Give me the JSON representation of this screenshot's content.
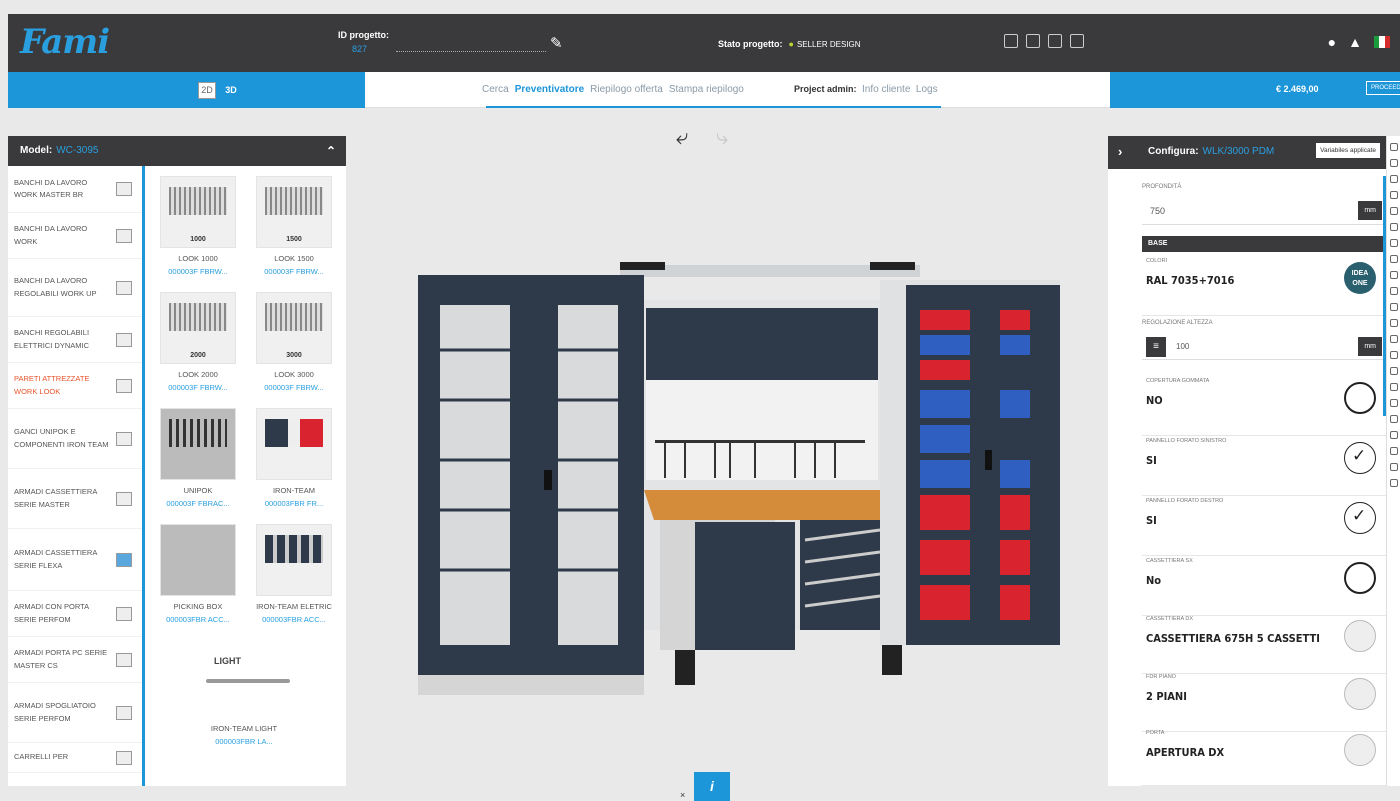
{
  "header": {
    "logo": "Fami",
    "id_label": "ID progetto:",
    "id_value": "827",
    "status_label": "Stato progetto:",
    "status_value": "SELLER DESIGN",
    "icons": [
      "file-icon",
      "save-icon",
      "folder-icon",
      "grid-icon"
    ],
    "user_icons": [
      "user-icon",
      "bell-icon",
      "italian-flag-icon"
    ]
  },
  "nav": {
    "view_2d": "2D",
    "view_3d": "3D",
    "tabs": [
      "Cerca",
      "Preventivatore",
      "Riepilogo offerta",
      "Stampa riepilogo"
    ],
    "active_tab": "Preventivatore",
    "project_admin_label": "Project admin:",
    "admin_links": [
      "Info cliente",
      "Logs"
    ],
    "price": "€ 2.469,00",
    "proceed_label": "PROCEED"
  },
  "model_panel": {
    "title": "Model:",
    "model_value": "WC-3095",
    "categories": [
      {
        "label": "BANCHI DA LAVORO WORK MASTER BR",
        "active": false
      },
      {
        "label": "BANCHI DA LAVORO WORK",
        "active": false
      },
      {
        "label": "BANCHI DA LAVORO REGOLABILI WORK UP",
        "active": false
      },
      {
        "label": "BANCHI REGOLABILI ELETTRICI DYNAMIC",
        "active": false
      },
      {
        "label": "PARETI ATTREZZATE WORK LOOK",
        "active": true
      },
      {
        "label": "GANCI UNIPOK E COMPONENTI IRON TEAM",
        "active": false
      },
      {
        "label": "ARMADI CASSETTIERA SERIE MASTER",
        "active": false
      },
      {
        "label": "ARMADI CASSETTIERA SERIE FLEXA",
        "active": false
      },
      {
        "label": "ARMADI CON PORTA SERIE PERFOM",
        "active": false
      },
      {
        "label": "ARMADI PORTA PC SERIE MASTER CS",
        "active": false
      },
      {
        "label": "ARMADI SPOGLIATOIO SERIE PERFOM",
        "active": false
      },
      {
        "label": "CARRELLI PER",
        "active": false
      }
    ],
    "products": [
      {
        "caption": "1000",
        "name": "LOOK 1000",
        "code": "000003F FBRW..."
      },
      {
        "caption": "1500",
        "name": "LOOK 1500",
        "code": "000003F FBRW..."
      },
      {
        "caption": "2000",
        "name": "LOOK 2000",
        "code": "000003F FBRW..."
      },
      {
        "caption": "3000",
        "name": "LOOK 3000",
        "code": "000003F FBRW..."
      },
      {
        "caption": "",
        "name": "UNIPOK",
        "code": "000003F FBRAC..."
      },
      {
        "caption": "",
        "name": "IRON-TEAM",
        "code": "000003FBR FR..."
      },
      {
        "caption": "",
        "name": "PICKING BOX",
        "code": "000003FBR ACC..."
      },
      {
        "caption": "",
        "name": "IRON-TEAM ELETRIC",
        "code": "000003FBR ACC..."
      }
    ],
    "light_title": "LIGHT",
    "light_item": {
      "name": "IRON-TEAM LIGHT",
      "code": "000003FBR LA..."
    }
  },
  "config_panel": {
    "title": "Configura:",
    "config_value": "WLK/3000 PDM",
    "variables_button": "Variabiles applicate",
    "profondita_label": "PROFONDITÀ",
    "profondita_value": "750",
    "unit": "mm",
    "base_label": "BASE",
    "colore_label": "COLORI",
    "colore_value": "RAL 7035+7016",
    "regolazione_label": "REGOLAZIONE ALTEZZA",
    "regolazione_value": "100",
    "options": [
      {
        "label": "COPERTURA GOMMATA",
        "value": "NO",
        "icon": "empty-circle-icon"
      },
      {
        "label": "PANNELLO FORATO SINISTRO",
        "value": "SI",
        "icon": "check-circle-icon"
      },
      {
        "label": "PANNELLO FORATO DESTRO",
        "value": "SI",
        "icon": "check-circle-icon"
      },
      {
        "label": "CASSETTIERA SX",
        "value": "No",
        "icon": "empty-circle-icon"
      },
      {
        "label": "CASSETTIERA DX",
        "value": "CASSETTIERA 675H 5 CASSETTI",
        "icon": "drawer-thumb-icon"
      },
      {
        "label": "FDR PIANO",
        "value": "2 PIANI",
        "icon": "shelf-thumb-icon"
      },
      {
        "label": "PORTA",
        "value": "APERTURA DX",
        "icon": "door-thumb-icon"
      }
    ],
    "idea_badge": "IDEA ONE"
  },
  "colors": {
    "brand_blue": "#1d96d9",
    "dark": "#3a3a3c",
    "active_category": "#e8552d",
    "cabinet": "#2e3a4a",
    "bin_red": "#d9232f",
    "bin_blue": "#2f5fc0",
    "worktop": "#d48b3a"
  }
}
